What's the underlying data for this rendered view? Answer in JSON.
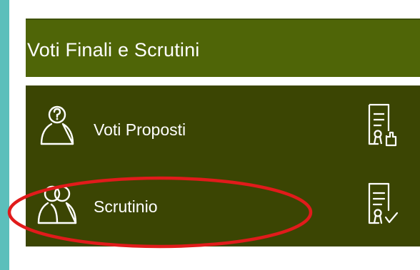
{
  "header": {
    "title": "Voti Finali e Scrutini"
  },
  "menu": {
    "items": [
      {
        "label": "Voti Proposti",
        "icon": "question-person-icon",
        "action_icon": "document-hand-icon"
      },
      {
        "label": "Scrutinio",
        "icon": "people-icon",
        "action_icon": "document-check-icon"
      }
    ]
  },
  "annotation": {
    "color": "#e11b1b",
    "shape": "ellipse"
  }
}
